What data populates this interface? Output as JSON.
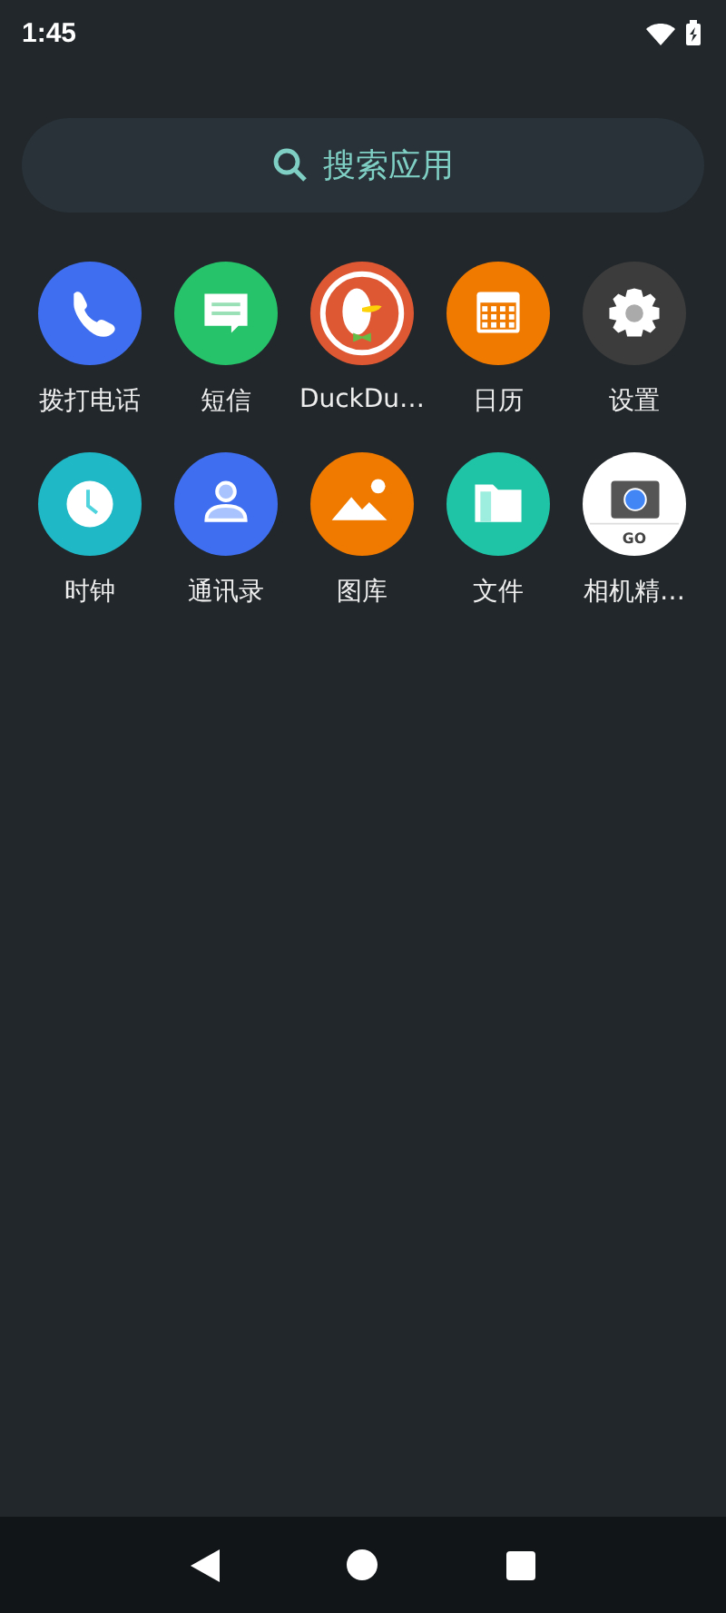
{
  "status_bar": {
    "time": "1:45"
  },
  "search": {
    "placeholder": "搜索应用"
  },
  "apps": [
    {
      "label": "拨打电话",
      "kind": "phone"
    },
    {
      "label": "短信",
      "kind": "messages"
    },
    {
      "label": "DuckDu…",
      "kind": "duck"
    },
    {
      "label": "日历",
      "kind": "calendar"
    },
    {
      "label": "设置",
      "kind": "settings"
    },
    {
      "label": "时钟",
      "kind": "clock"
    },
    {
      "label": "通讯录",
      "kind": "contacts"
    },
    {
      "label": "图库",
      "kind": "gallery"
    },
    {
      "label": "文件",
      "kind": "files"
    },
    {
      "label": "相机精…",
      "kind": "camera",
      "badge": "GO"
    }
  ]
}
